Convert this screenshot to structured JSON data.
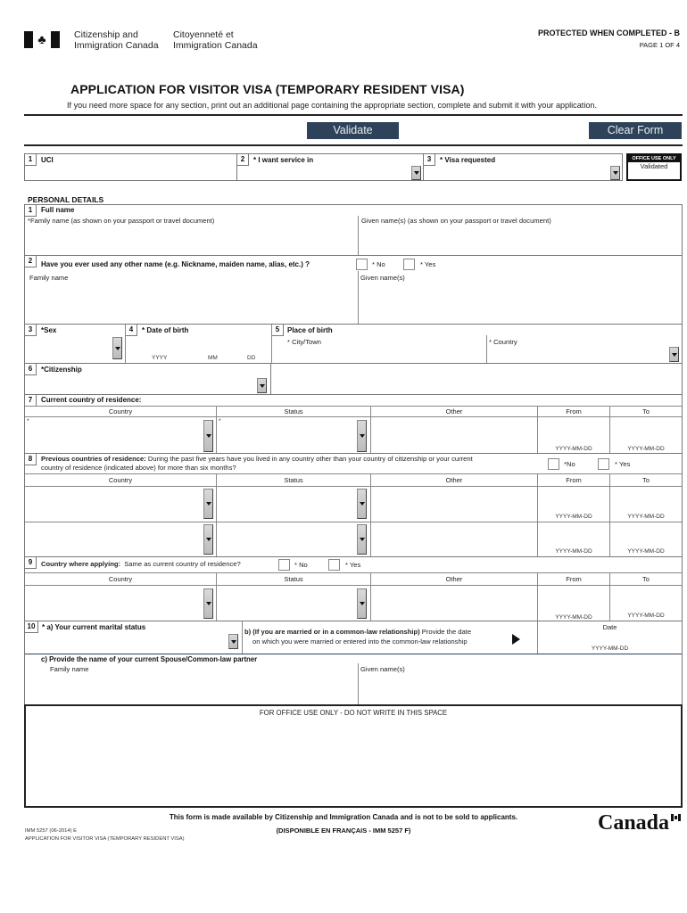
{
  "header": {
    "dept_en_line1": "Citizenship and",
    "dept_en_line2": "Immigration Canada",
    "dept_fr_line1": "Citoyenneté et",
    "dept_fr_line2": "Immigration Canada",
    "protected": "PROTECTED WHEN COMPLETED - B",
    "page": "PAGE 1 OF 4",
    "title": "APPLICATION FOR VISITOR VISA (TEMPORARY RESIDENT VISA)",
    "subtitle": "If you need more space for any section, print out an additional page containing the appropriate section, complete and submit it with your application.",
    "flag_icon": "maple-leaf"
  },
  "toolbar": {
    "validate_label": "Validate",
    "clear_label": "Clear Form"
  },
  "top_fields": {
    "uci": {
      "num": "1",
      "label": "UCI",
      "value": ""
    },
    "service": {
      "num": "2",
      "label": "* I want service in",
      "value": ""
    },
    "visa": {
      "num": "3",
      "label": "* Visa requested",
      "value": ""
    },
    "office_use": {
      "header": "OFFICE USE ONLY",
      "value": "Validated"
    }
  },
  "personal": {
    "section_title": "PERSONAL DETAILS",
    "q1": {
      "num": "1",
      "label": "Full name",
      "family_label": "*Family name  (as shown on your passport or travel document)",
      "given_label": "Given name(s)  (as shown on your passport or travel document)"
    },
    "q2": {
      "num": "2",
      "label": "Have you ever used any other name (e.g. Nickname, maiden name, alias, etc.) ?",
      "no": "* No",
      "yes": "* Yes",
      "family_label": "Family name",
      "given_label": "Given name(s)"
    },
    "q3": {
      "num": "3",
      "label": "*Sex"
    },
    "q4": {
      "num": "4",
      "label": "* Date of birth",
      "yyyy": "YYYY",
      "mm": "MM",
      "dd": "DD"
    },
    "q5": {
      "num": "5",
      "label": "Place of birth",
      "city": "* City/Town",
      "country": "* Country"
    },
    "q6": {
      "num": "6",
      "label": "*Citizenship"
    },
    "q7": {
      "num": "7",
      "label": "Current country of residence:",
      "req_mark": "*"
    },
    "q8": {
      "num": "8",
      "label_bold": "Previous countries of residence:",
      "label_rest": " During the past five years have you lived in any country other than your country of citizenship or your current",
      "label_line2": "country of residence (indicated above) for more than six months?",
      "no": "*No",
      "yes": "* Yes"
    },
    "q9": {
      "num": "9",
      "label_bold": "Country where applying:",
      "label_rest": "Same as current country of residence?",
      "no": "* No",
      "yes": "* Yes"
    },
    "q10": {
      "num": "10",
      "a_label": "* a) Your current marital status",
      "b_bold": "b) (If you are married or in a common-law relationship)",
      "b_rest": " Provide the date",
      "b_line2": "on which you were married or entered into the common-law relationship",
      "date_label": "Date",
      "date_hint": "YYYY-MM-DD",
      "c_label": "c) Provide the name of your current Spouse/Common-law partner",
      "family_label": "Family name",
      "given_label": "Given name(s)"
    },
    "columns": [
      "Country",
      "Status",
      "Other",
      "From",
      "To"
    ],
    "date_hint": "YYYY-MM-DD"
  },
  "office_box": {
    "label": "FOR OFFICE USE ONLY - DO NOT WRITE IN THIS SPACE"
  },
  "footer": {
    "line1": "This form is made available by Citizenship and Immigration Canada and is not to be sold to applicants.",
    "line2": "(DISPONIBLE EN FRANÇAIS - IMM 5257 F)",
    "form_code": "IMM 5257 (06-2014) E",
    "form_name": "APPLICATION FOR VISITOR VISA (TEMPORARY RESIDENT VISA)",
    "wordmark": "Canada"
  }
}
